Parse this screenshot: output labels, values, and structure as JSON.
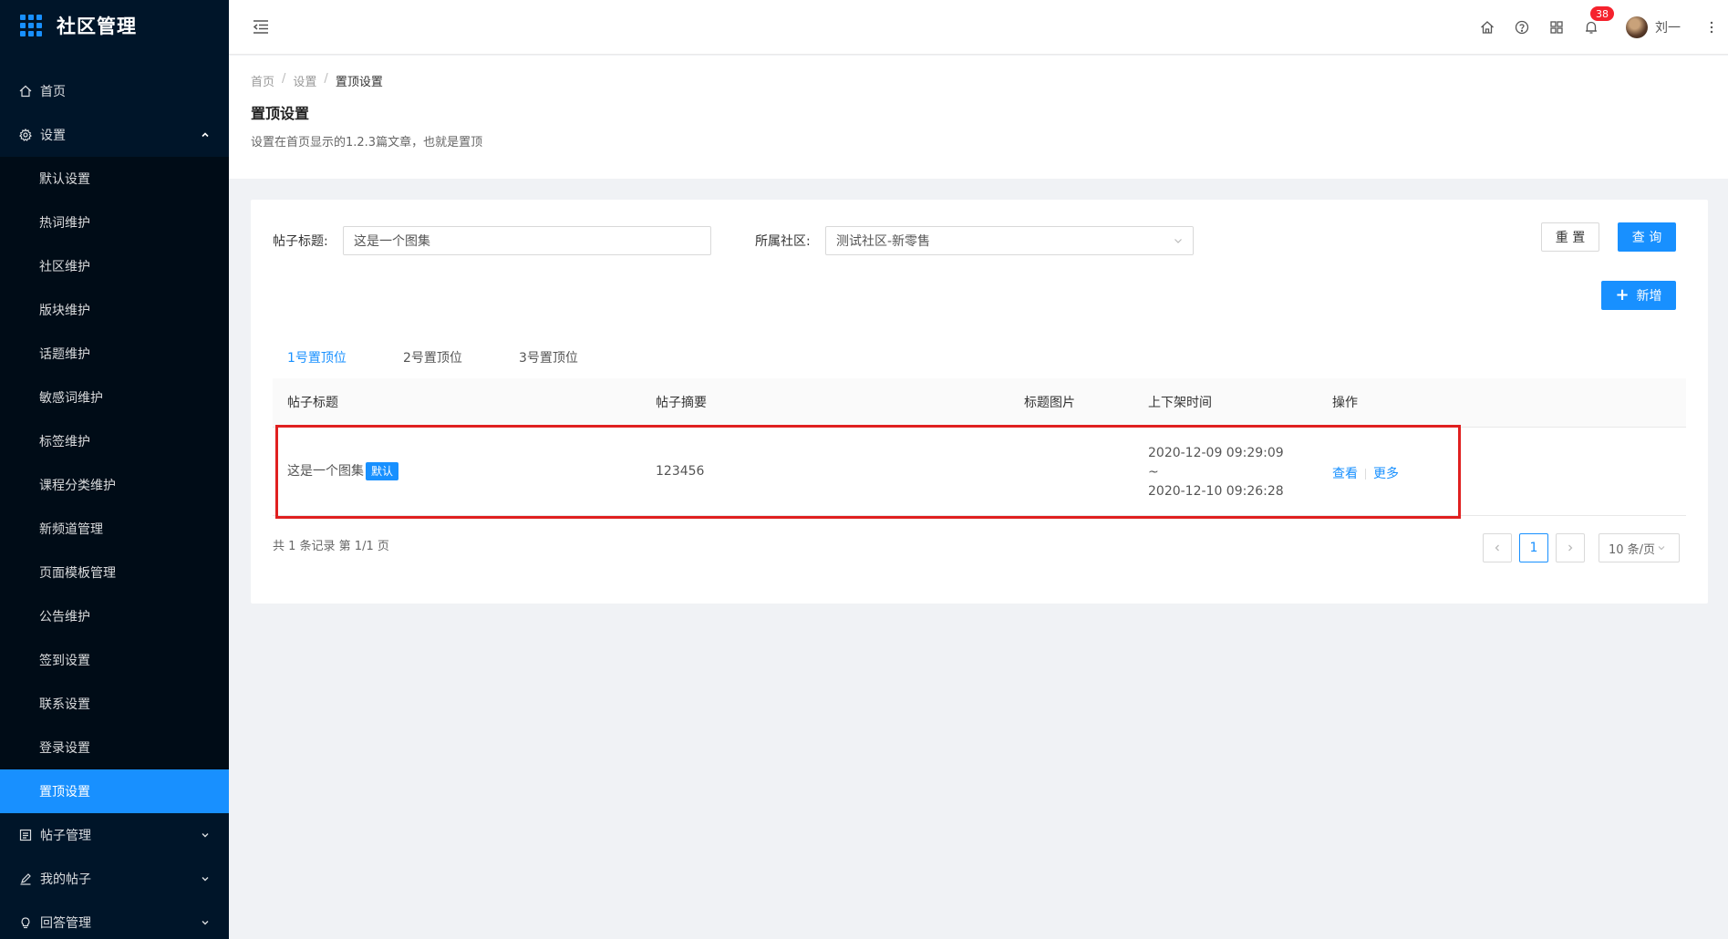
{
  "app": {
    "title": "社区管理"
  },
  "sidebar": {
    "home": "首页",
    "settings": {
      "label": "设置",
      "items": [
        "默认设置",
        "热词维护",
        "社区维护",
        "版块维护",
        "话题维护",
        "敏感词维护",
        "标签维护",
        "课程分类维护",
        "新频道管理",
        "页面模板管理",
        "公告维护",
        "签到设置",
        "联系设置",
        "登录设置",
        "置顶设置"
      ],
      "active": "置顶设置"
    },
    "posts": "帖子管理",
    "my_posts": "我的帖子",
    "answers": "回答管理"
  },
  "header": {
    "notification_count": "38",
    "username": "刘一"
  },
  "page": {
    "breadcrumb": [
      "首页",
      "设置",
      "置顶设置"
    ],
    "title": "置顶设置",
    "description": "设置在首页显示的1.2.3篇文章，也就是置顶"
  },
  "filters": {
    "title_label": "帖子标题:",
    "title_value": "这是一个图集",
    "community_label": "所属社区:",
    "community_value": "测试社区-新零售",
    "reset": "重 置",
    "search": "查 询",
    "add": "新增"
  },
  "tabs": [
    "1号置顶位",
    "2号置顶位",
    "3号置顶位"
  ],
  "table": {
    "columns": [
      "帖子标题",
      "帖子摘要",
      "标题图片",
      "上下架时间",
      "操作"
    ],
    "rows": [
      {
        "title": "这是一个图集",
        "tag": "默认",
        "summary": "123456",
        "image": "",
        "time_start": "2020-12-09 09:29:09",
        "time_sep": "~",
        "time_end": "2020-12-10 09:26:28",
        "action_view": "查看",
        "action_more": "更多"
      }
    ]
  },
  "pagination": {
    "total": "共 1 条记录 第 1/1 页",
    "current": "1",
    "page_size": "10 条/页"
  }
}
